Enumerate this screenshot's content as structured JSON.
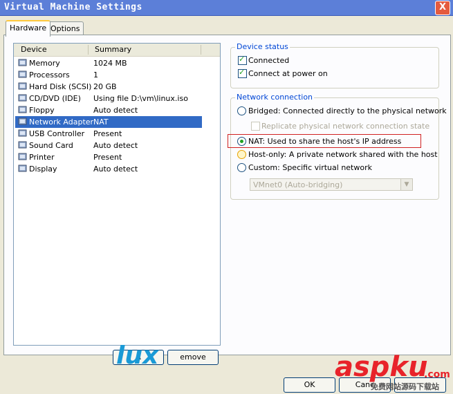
{
  "window": {
    "title": "Virtual Machine Settings",
    "close_glyph": "X"
  },
  "tabs": [
    {
      "label": "Hardware"
    },
    {
      "label": "Options"
    }
  ],
  "device_list": {
    "col_device": "Device",
    "col_summary": "Summary",
    "rows": [
      {
        "device": "Memory",
        "summary": "1024 MB",
        "icon": "memory-icon"
      },
      {
        "device": "Processors",
        "summary": "1",
        "icon": "processor-icon"
      },
      {
        "device": "Hard Disk (SCSI)",
        "summary": "20 GB",
        "icon": "hard-disk-icon"
      },
      {
        "device": "CD/DVD (IDE)",
        "summary": "Using file D:\\vm\\linux.iso",
        "icon": "cd-dvd-icon"
      },
      {
        "device": "Floppy",
        "summary": "Auto detect",
        "icon": "floppy-icon"
      },
      {
        "device": "Network Adapter",
        "summary": "NAT",
        "icon": "network-adapter-icon",
        "selected": true
      },
      {
        "device": "USB Controller",
        "summary": "Present",
        "icon": "usb-icon"
      },
      {
        "device": "Sound Card",
        "summary": "Auto detect",
        "icon": "sound-card-icon"
      },
      {
        "device": "Printer",
        "summary": "Present",
        "icon": "printer-icon"
      },
      {
        "device": "Display",
        "summary": "Auto detect",
        "icon": "display-icon"
      }
    ]
  },
  "device_status": {
    "title": "Device status",
    "connected": "Connected",
    "connect_at_power_on": "Connect at power on"
  },
  "network_connection": {
    "title": "Network connection",
    "bridged": "Bridged: Connected directly to the physical network",
    "replicate": "Replicate physical network connection state",
    "nat": "NAT: Used to share the host's IP address",
    "host_only": "Host-only: A private network shared with the host",
    "custom": "Custom: Specific virtual network",
    "vmnet_select": "VMnet0 (Auto-bridging)"
  },
  "buttons": {
    "add_partial": "A",
    "remove_partial": "emove",
    "ok": "OK",
    "cancel_partial": "Canc"
  },
  "watermarks": {
    "site": "aspku",
    "site_suffix": ".com",
    "tagline": "免费网站源码下载站",
    "logo_text": "lux"
  },
  "colors": {
    "selection": "#316ac5",
    "group_title": "#0046d5",
    "highlight_border": "#d02020",
    "check_green": "#21a121"
  }
}
